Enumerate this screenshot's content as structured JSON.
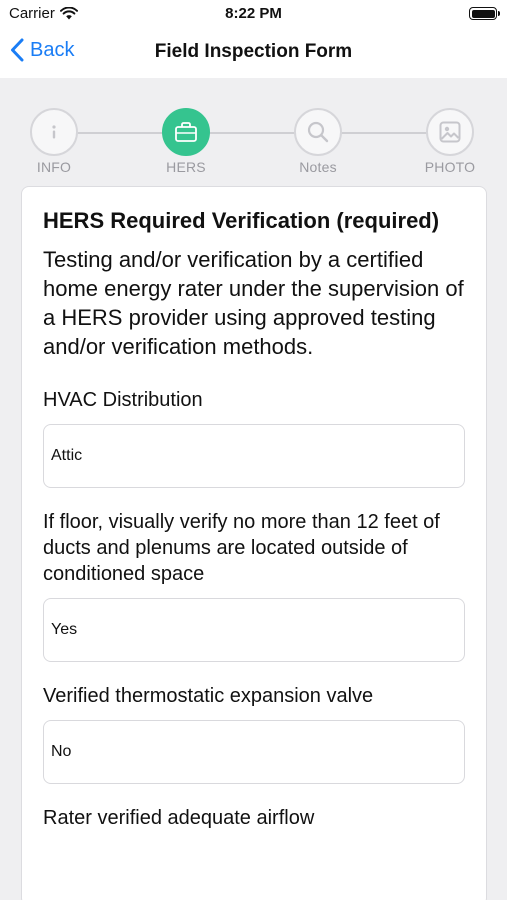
{
  "status_bar": {
    "carrier": "Carrier",
    "time": "8:22 PM",
    "battery_level": 1.0
  },
  "nav": {
    "back_label": "Back",
    "title": "Field Inspection Form"
  },
  "steps": [
    {
      "label": "INFO",
      "icon": "info-icon",
      "active": false
    },
    {
      "label": "HERS",
      "icon": "briefcase-icon",
      "active": true
    },
    {
      "label": "Notes",
      "icon": "search-icon",
      "active": false
    },
    {
      "label": "PHOTO",
      "icon": "photo-icon",
      "active": false
    }
  ],
  "section": {
    "title": "HERS Required Verification (required)",
    "description": "Testing and/or verification by a certified home energy rater under the supervision of a HERS provider using approved testing and/or verification methods."
  },
  "questions": [
    {
      "label": "HVAC Distribution",
      "value": "Attic"
    },
    {
      "label": "If floor, visually verify no more than 12 feet of ducts and plenums are located outside of conditioned space",
      "value": "Yes"
    },
    {
      "label": "Verified thermostatic expansion valve",
      "value": "No"
    },
    {
      "label": "Rater verified adequate airflow"
    }
  ],
  "colors": {
    "accent_blue": "#1a7df5",
    "active_step": "#35c48f",
    "background": "#efeff1"
  }
}
